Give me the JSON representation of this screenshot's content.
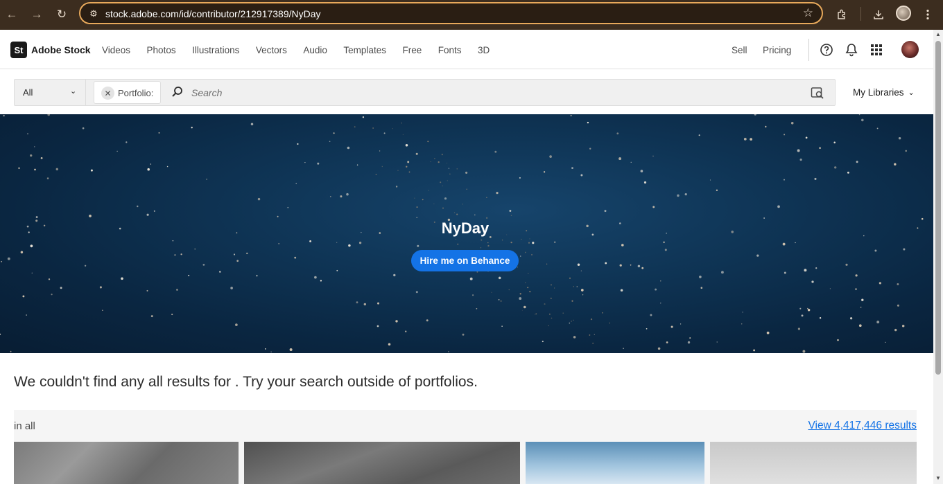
{
  "browser": {
    "url": "stock.adobe.com/id/contributor/212917389/NyDay"
  },
  "header": {
    "logo_mark": "St",
    "logo_name": "Adobe Stock",
    "nav": [
      "Videos",
      "Photos",
      "Illustrations",
      "Vectors",
      "Audio",
      "Templates",
      "Free",
      "Fonts",
      "3D"
    ],
    "sell": "Sell",
    "pricing": "Pricing"
  },
  "search": {
    "filter": "All",
    "chip": "Portfolio:",
    "placeholder": "Search",
    "my_libraries": "My Libraries"
  },
  "hero": {
    "title": "NyDay",
    "button": "Hire me on Behance"
  },
  "results": {
    "message": "We couldn't find any all results for . Try your search outside of portfolios.",
    "scope": "in all",
    "view_all": "View 4,417,446 results"
  },
  "colors": {
    "accent": "#1473e6",
    "hero_bg": "#0f3556",
    "chrome_bg": "#3c2d1f",
    "omnibox_border": "#e8a95b"
  },
  "icons": [
    "back-icon",
    "forward-icon",
    "reload-icon",
    "site-info-icon",
    "bookmark-star-icon",
    "extensions-icon",
    "download-icon",
    "menu-dots-icon",
    "help-icon",
    "bell-icon",
    "apps-grid-icon",
    "search-icon",
    "visual-search-icon",
    "chevron-down-icon",
    "close-icon"
  ]
}
